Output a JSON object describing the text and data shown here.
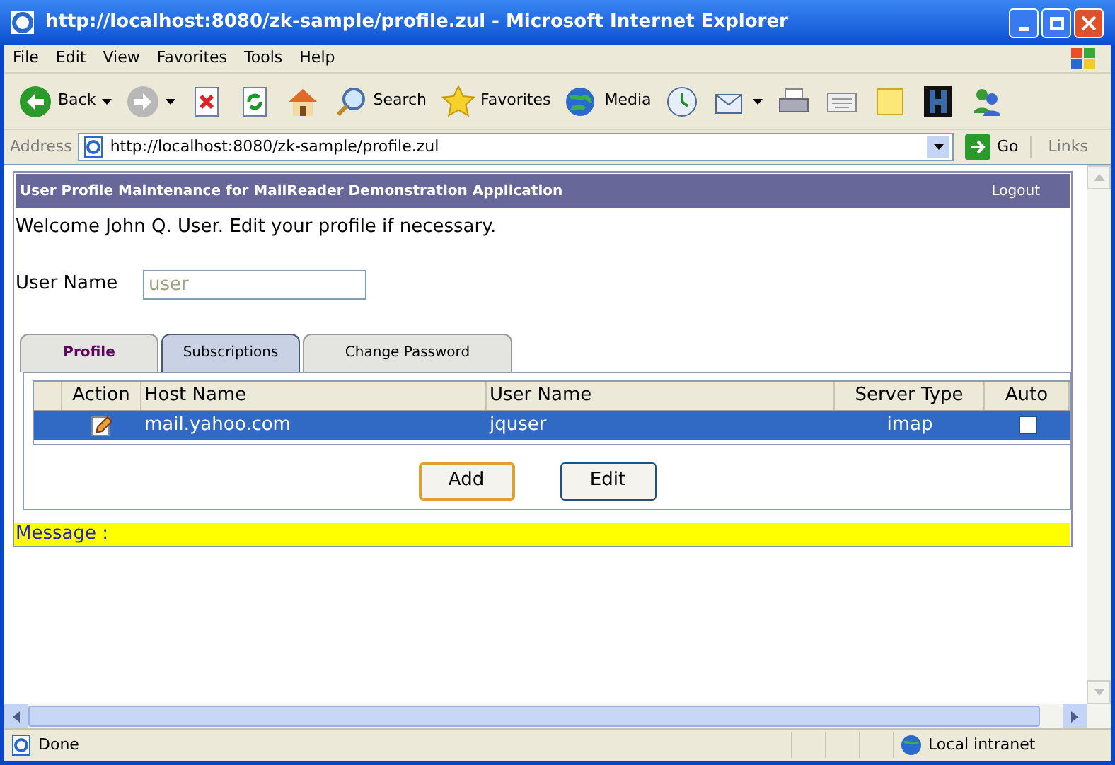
{
  "window": {
    "title": "http://localhost:8080/zk-sample/profile.zul - Microsoft Internet Explorer"
  },
  "menu": [
    "File",
    "Edit",
    "View",
    "Favorites",
    "Tools",
    "Help"
  ],
  "toolbar": [
    {
      "kind": "back",
      "label": "Back"
    },
    {
      "kind": "forward"
    },
    {
      "kind": "stop"
    },
    {
      "kind": "refresh"
    },
    {
      "kind": "home"
    },
    {
      "kind": "search",
      "label": "Search"
    },
    {
      "kind": "favorites",
      "label": "Favorites"
    },
    {
      "kind": "media",
      "label": "Media"
    },
    {
      "kind": "history"
    },
    {
      "kind": "mail"
    },
    {
      "kind": "print"
    },
    {
      "kind": "edit"
    },
    {
      "kind": "note"
    },
    {
      "kind": "h"
    },
    {
      "kind": "messenger"
    }
  ],
  "address_bar": {
    "label": "Address",
    "url": "http://localhost:8080/zk-sample/profile.zul",
    "go": "Go",
    "links": "Links"
  },
  "page": {
    "header": {
      "title": "User Profile Maintenance for MailReader Demonstration Application",
      "logout": "Logout"
    },
    "welcome": "Welcome John Q. User. Edit your profile if necessary.",
    "user_name": {
      "label": "User Name",
      "value": "user",
      "disabled": true
    },
    "tabs": [
      {
        "label": "Profile",
        "selected": false
      },
      {
        "label": "Subscriptions",
        "selected": true
      },
      {
        "label": "Change Password",
        "selected": false
      }
    ],
    "table": {
      "columns": [
        "Action",
        "Host Name",
        "User Name",
        "Server Type",
        "Auto"
      ],
      "rows": [
        {
          "selected": true,
          "host": "mail.yahoo.com",
          "user": "jquser",
          "type": "imap",
          "auto": false
        }
      ]
    },
    "buttons": [
      {
        "label": "Add",
        "focused": true
      },
      {
        "label": "Edit",
        "focused": false
      }
    ],
    "message": "Message :"
  },
  "status_bar": {
    "text": "Done",
    "zone": "Local intranet"
  }
}
